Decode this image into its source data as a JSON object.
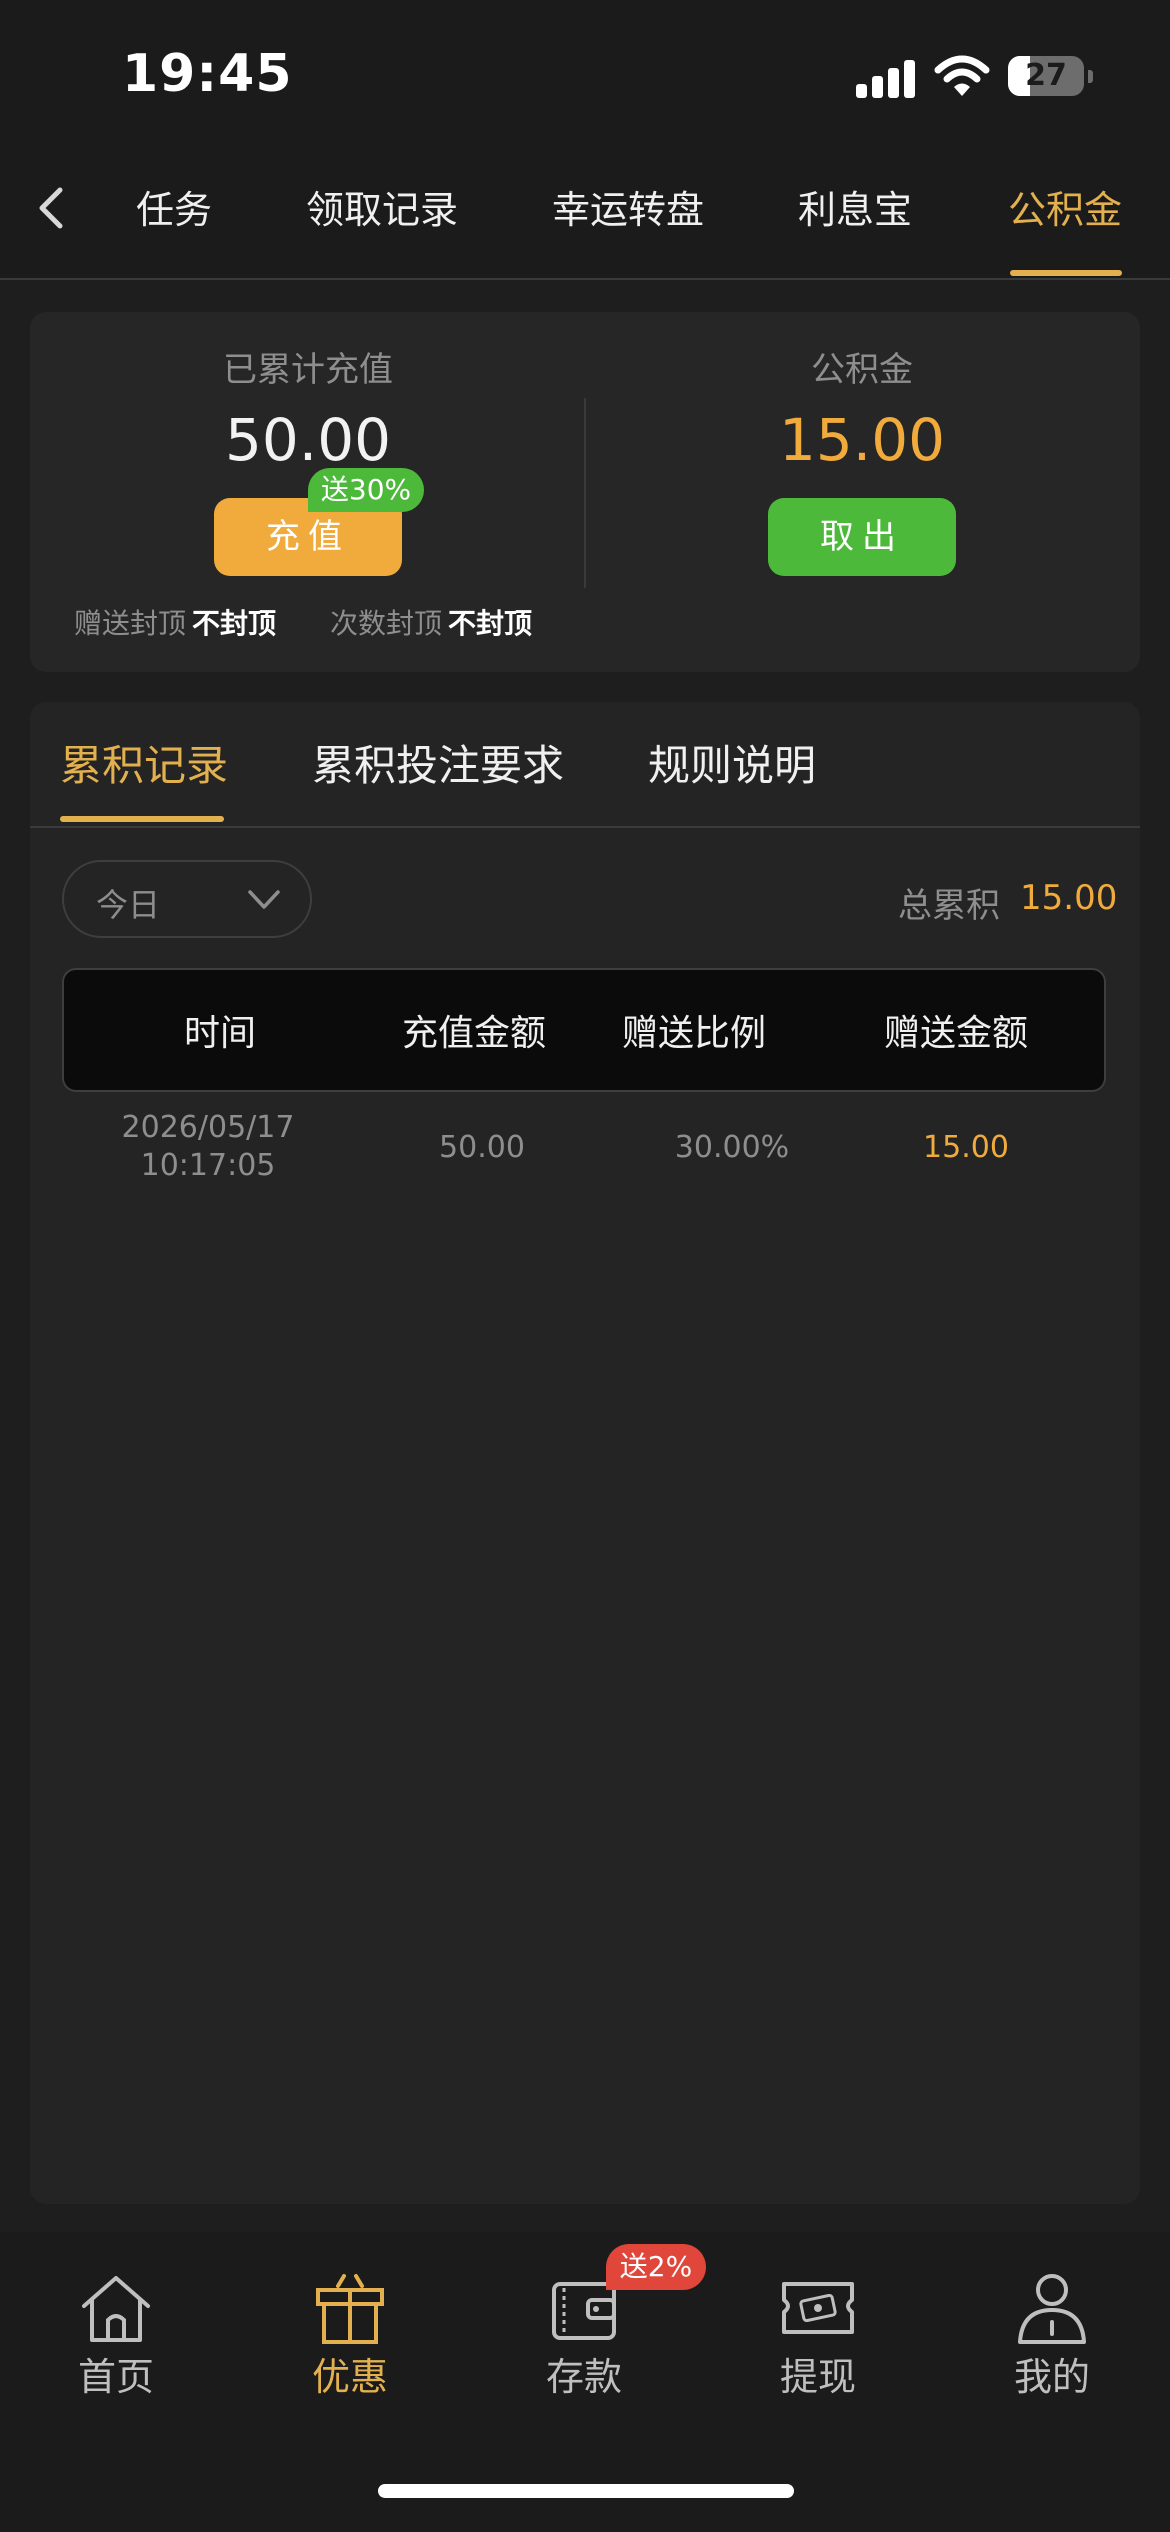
{
  "status_bar": {
    "time": "19:45",
    "battery": "27"
  },
  "top_nav": {
    "tabs": [
      {
        "label": "任务"
      },
      {
        "label": "领取记录"
      },
      {
        "label": "幸运转盘"
      },
      {
        "label": "利息宝"
      },
      {
        "label": "公积金"
      }
    ],
    "active_tab": "公积金"
  },
  "summary": {
    "recharged_label": "已累计充值",
    "recharged_value": "50.00",
    "recharge_button": "充值",
    "recharge_badge": "送30%",
    "fund_label": "公积金",
    "fund_value": "15.00",
    "withdraw_button": "取出",
    "bonus_cap_label": "赠送封顶",
    "bonus_cap_value": "不封顶",
    "count_cap_label": "次数封顶",
    "count_cap_value": "不封顶"
  },
  "records": {
    "tabs": [
      {
        "label": "累积记录"
      },
      {
        "label": "累积投注要求"
      },
      {
        "label": "规则说明"
      }
    ],
    "active_tab": "累积记录",
    "date_filter": "今日",
    "total_label": "总累积",
    "total_value": "15.00",
    "columns": [
      "时间",
      "充值金额",
      "赠送比例",
      "赠送金额"
    ],
    "rows": [
      {
        "date": "2026/05/17",
        "time": "10:17:05",
        "amount": "50.00",
        "ratio": "30.00%",
        "bonus": "15.00"
      }
    ]
  },
  "tabbar": {
    "items": [
      {
        "label": "首页",
        "icon": "home-icon"
      },
      {
        "label": "优惠",
        "icon": "gift-icon"
      },
      {
        "label": "存款",
        "icon": "wallet-icon"
      },
      {
        "label": "提现",
        "icon": "ticket-icon"
      },
      {
        "label": "我的",
        "icon": "user-icon"
      }
    ],
    "active": "优惠",
    "deposit_badge": "送2%"
  },
  "colors": {
    "accent_gold": "#e3b04f",
    "orange": "#f0ab3c",
    "green": "#4cb93b",
    "red": "#e0463a",
    "background": "#1e1e1e"
  }
}
